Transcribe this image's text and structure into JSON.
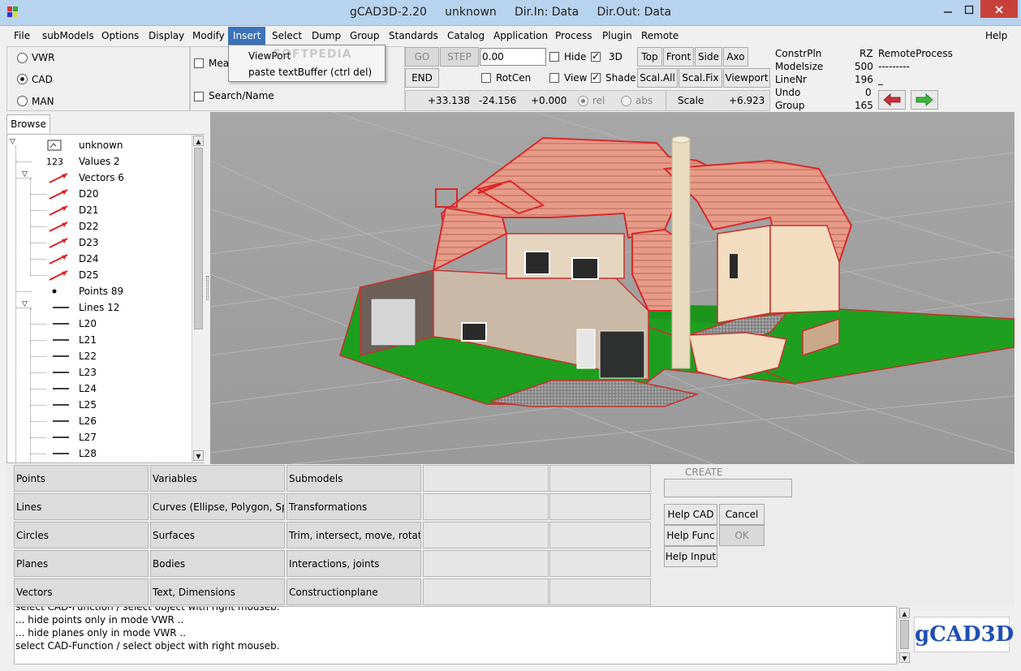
{
  "window": {
    "title": "gCAD3D-2.20     unknown     Dir.In: Data     Dir.Out: Data",
    "minimize_icon": "minimize-icon",
    "maximize_icon": "maximize-icon",
    "close_icon": "close-icon"
  },
  "menubar": {
    "items": [
      "File",
      "subModels",
      "Options",
      "Display",
      "Modify",
      "Insert",
      "Select",
      "Dump",
      "Group",
      "Standards",
      "Catalog",
      "Application",
      "Process",
      "Plugin",
      "Remote"
    ],
    "help": "Help",
    "active": "Insert"
  },
  "insert_menu": {
    "items": [
      "ViewPort",
      "paste textBuffer (ctrl del)"
    ]
  },
  "mode": {
    "options": [
      "VWR",
      "CAD",
      "MAN"
    ],
    "selected": "CAD"
  },
  "filters": {
    "measure_label": "Mea",
    "search_label": "Search/Name"
  },
  "toolbar": {
    "go": "GO",
    "step": "STEP",
    "end": "END",
    "input_value": "0.00",
    "hide": "Hide",
    "three_d": "3D",
    "rotcen": "RotCen",
    "view": "View",
    "shade": "Shade",
    "top": "Top",
    "front": "Front",
    "side": "Side",
    "axo": "Axo",
    "scal_all": "Scal.All",
    "scal_fix": "Scal.Fix",
    "viewport": "Viewport",
    "coord_x": "+33.138",
    "coord_y": "-24.156",
    "coord_z": "+0.000",
    "rel": "rel",
    "abs": "abs",
    "scale_label": "Scale",
    "scale_value": "+6.923",
    "checks": {
      "hide": false,
      "three_d": true,
      "rotcen": false,
      "view": false,
      "shade": true
    }
  },
  "status": {
    "constrpln_label": "ConstrPln",
    "constrpln_value": "RZ",
    "modelsize_label": "Modelsize",
    "modelsize_value": "500",
    "linenr_label": "LineNr",
    "linenr_value": "196",
    "undo_label": "Undo",
    "undo_value": "0",
    "group_label": "Group",
    "group_value": "165",
    "remote_title": "RemoteProcess",
    "remote_dashes": "---------",
    "remote_cursor": "_",
    "back_icon": "arrow-left-icon",
    "forward_icon": "arrow-right-icon"
  },
  "browse": {
    "tab": "Browse",
    "tree": [
      {
        "label": "unknown",
        "icon": "model-icon",
        "level": 0,
        "expander": true
      },
      {
        "label": "Values 2",
        "icon": "values-icon",
        "icon_text": "123",
        "level": 1
      },
      {
        "label": "Vectors 6",
        "icon": "vector-icon",
        "level": 1,
        "expander": true
      },
      {
        "label": "D20",
        "icon": "vector-icon",
        "level": 2
      },
      {
        "label": "D21",
        "icon": "vector-icon",
        "level": 2
      },
      {
        "label": "D22",
        "icon": "vector-icon",
        "level": 2
      },
      {
        "label": "D23",
        "icon": "vector-icon",
        "level": 2
      },
      {
        "label": "D24",
        "icon": "vector-icon",
        "level": 2
      },
      {
        "label": "D25",
        "icon": "vector-icon",
        "level": 2
      },
      {
        "label": "Points 89",
        "icon": "point-icon",
        "level": 1
      },
      {
        "label": "Lines 12",
        "icon": "line-icon",
        "level": 1,
        "expander": true
      },
      {
        "label": "L20",
        "icon": "line-icon",
        "level": 2
      },
      {
        "label": "L21",
        "icon": "line-icon",
        "level": 2
      },
      {
        "label": "L22",
        "icon": "line-icon",
        "level": 2
      },
      {
        "label": "L23",
        "icon": "line-icon",
        "level": 2
      },
      {
        "label": "L24",
        "icon": "line-icon",
        "level": 2
      },
      {
        "label": "L25",
        "icon": "line-icon",
        "level": 2
      },
      {
        "label": "L26",
        "icon": "line-icon",
        "level": 2
      },
      {
        "label": "L27",
        "icon": "line-icon",
        "level": 2
      },
      {
        "label": "L28",
        "icon": "line-icon",
        "level": 2
      }
    ]
  },
  "functions": {
    "col1": [
      "Points",
      "Lines",
      "Circles",
      "Planes",
      "Vectors"
    ],
    "col2": [
      "Variables",
      "Curves (Ellipse, Polygon, Spli",
      "Surfaces",
      "Bodies",
      "Text, Dimensions"
    ],
    "col3": [
      "Submodels",
      "Transformations",
      "Trim, intersect, move, rotate",
      "Interactions, joints",
      "Constructionplane"
    ]
  },
  "create": {
    "title": "CREATE",
    "help_cad": "Help CAD",
    "cancel": "Cancel",
    "help_func": "Help Func",
    "ok": "OK",
    "help_input": "Help Input"
  },
  "messages": [
    "select CAD-Function / select object with right mouseb.",
    "... hide points only in mode VWR ..",
    "... hide planes only in mode VWR ..",
    "select CAD-Function / select object with right mouseb."
  ],
  "logo": "gCAD3D",
  "watermark": "SOFTPEDIA",
  "colors": {
    "grass": "#1e9e1e",
    "roof": "#e89a88",
    "roof_edge": "#d62a2a",
    "wall": "#f0dcc0",
    "viewport_bg": "#a3a3a3",
    "menu_active": "#3b73b9",
    "logo": "#1f4fb4"
  }
}
